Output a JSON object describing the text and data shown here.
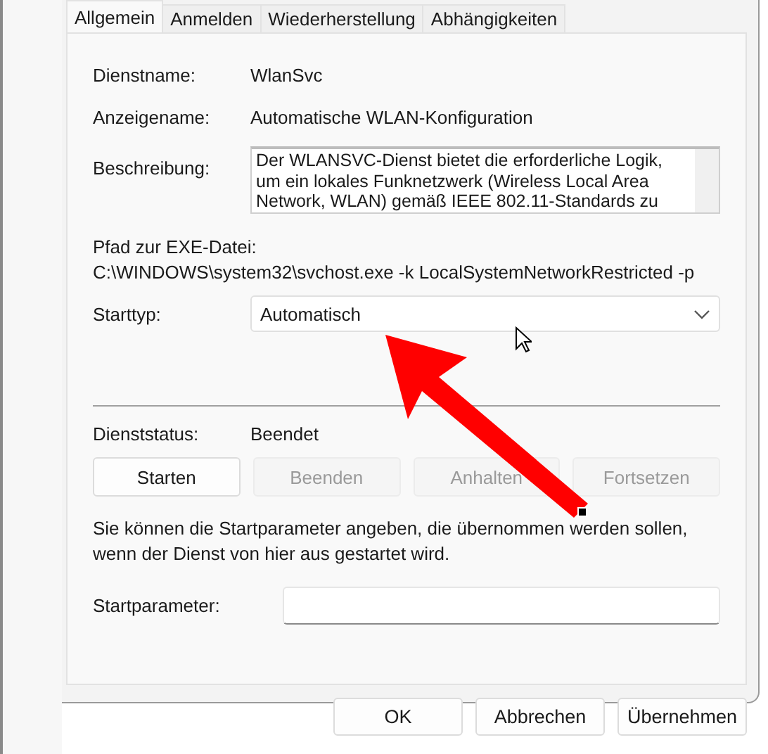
{
  "tabs": [
    {
      "label": "Allgemein",
      "selected": true
    },
    {
      "label": "Anmelden",
      "selected": false
    },
    {
      "label": "Wiederherstellung",
      "selected": false
    },
    {
      "label": "Abhängigkeiten",
      "selected": false
    }
  ],
  "service_name": {
    "label": "Dienstname:",
    "value": "WlanSvc"
  },
  "display_name": {
    "label": "Anzeigename:",
    "value": "Automatische WLAN-Konfiguration"
  },
  "description": {
    "label": "Beschreibung:",
    "value": "Der WLANSVC-Dienst bietet die erforderliche Logik, um ein lokales Funknetzwerk (Wireless Local Area Network, WLAN) gemäß IEEE 802.11-Standards zu"
  },
  "exe_path": {
    "label": "Pfad zur EXE-Datei:",
    "value": "C:\\WINDOWS\\system32\\svchost.exe -k LocalSystemNetworkRestricted -p"
  },
  "startup_type": {
    "label": "Starttyp:",
    "value": "Automatisch"
  },
  "service_status": {
    "label": "Dienststatus:",
    "value": "Beendet"
  },
  "service_buttons": [
    {
      "label": "Starten",
      "disabled": false
    },
    {
      "label": "Beenden",
      "disabled": true
    },
    {
      "label": "Anhalten",
      "disabled": true
    },
    {
      "label": "Fortsetzen",
      "disabled": true
    }
  ],
  "hint": "Sie können die Startparameter angeben, die übernommen werden sollen, wenn der Dienst von hier aus gestartet wird.",
  "start_parameters": {
    "label": "Startparameter:"
  },
  "dialog_buttons": [
    "OK",
    "Abbrechen",
    "Übernehmen"
  ]
}
